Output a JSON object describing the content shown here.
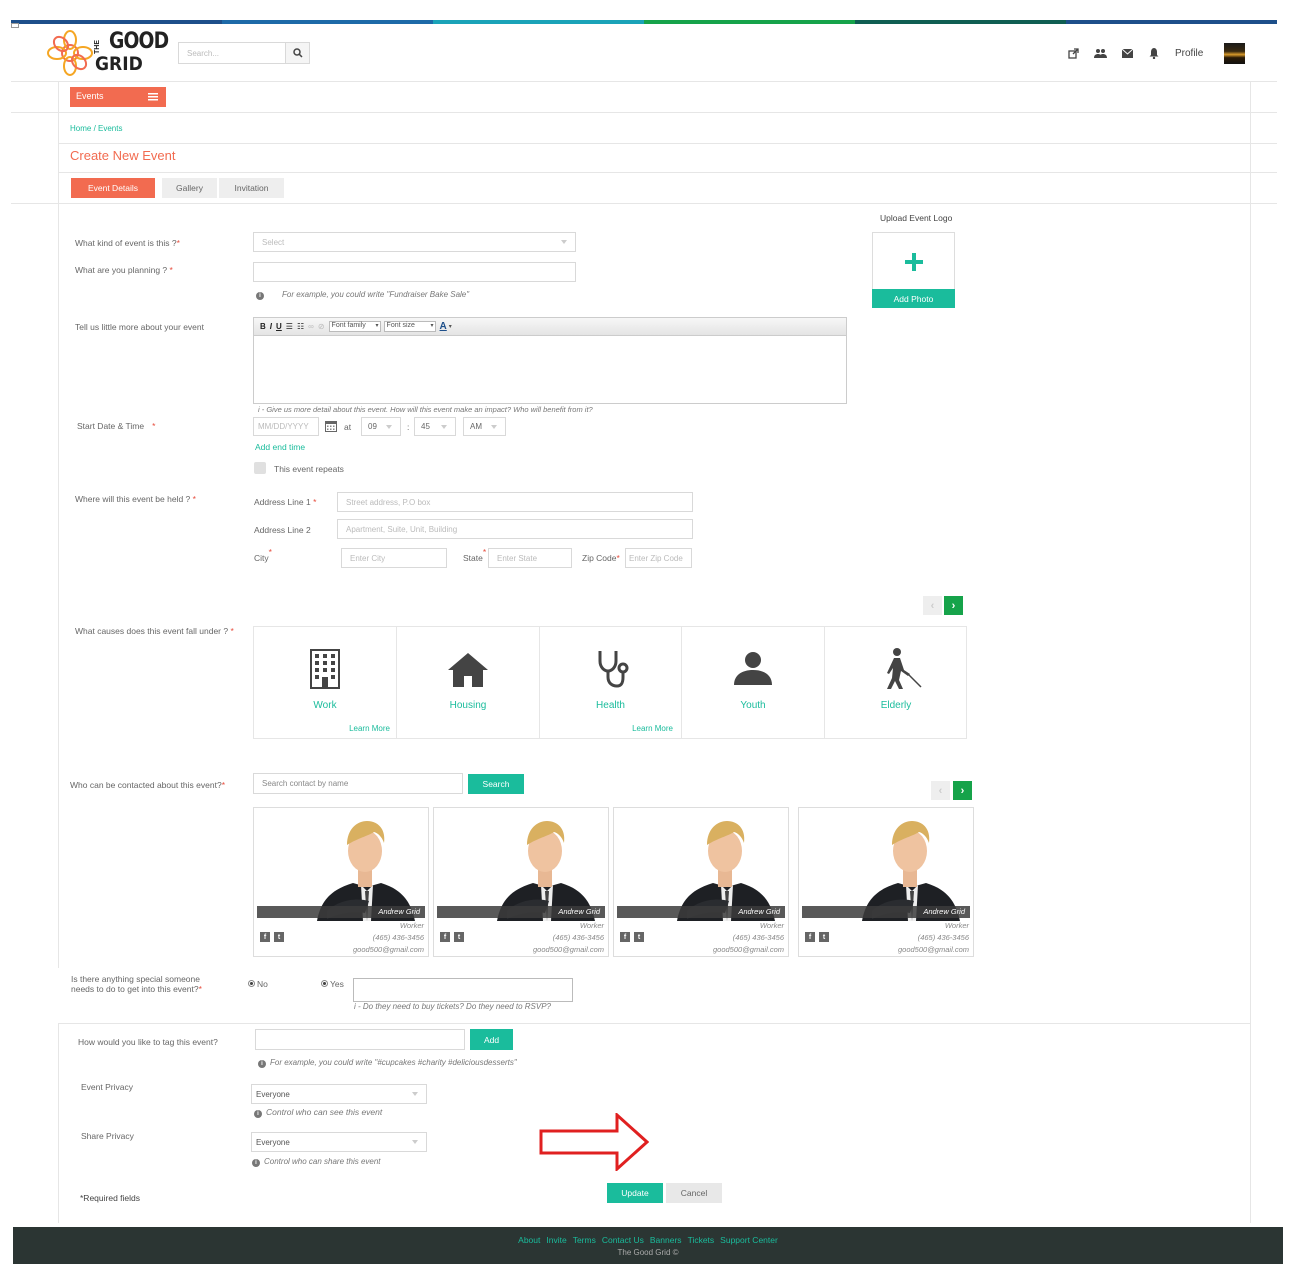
{
  "header": {
    "logo_line1": "THE",
    "logo_line2": "GOOD",
    "logo_line3": "GRID",
    "search_placeholder": "Search...",
    "profile_label": "Profile",
    "icons": [
      "external-link-icon",
      "users-icon",
      "mail-icon",
      "bell-icon"
    ]
  },
  "menu": {
    "events_label": "Events"
  },
  "breadcrumb": {
    "home": "Home",
    "sep": " / ",
    "current": "Events"
  },
  "page_title": "Create New Event",
  "tabs": [
    {
      "label": "Event Details",
      "active": true
    },
    {
      "label": "Gallery",
      "active": false
    },
    {
      "label": "Invitation",
      "active": false
    }
  ],
  "form": {
    "kind_label": "What kind of event is this ?",
    "kind_select": "Select",
    "planning_label": "What are you planning ? ",
    "planning_value": "",
    "planning_hint": "For example, you could write \"Fundraiser Bake Sale\"",
    "about_label": "Tell us little more about your event",
    "editor": {
      "bold": "B",
      "italic": "I",
      "underline": "U",
      "font_family": "Font family",
      "font_size": "Font size",
      "color": "A"
    },
    "about_hint": "i - Give us more detail about this event.  How will this event make an impact?  Who will benefit from it?",
    "start_label": "Start Date & Time",
    "date_placeholder": "MM/DD/YYYY",
    "at_label": "at",
    "hour": "09",
    "colon": ":",
    "minute": "45",
    "ampm": "AM",
    "add_end_time": "Add end time",
    "repeats_label": "This event repeats",
    "where_label": "Where will this event be held ? ",
    "addr1_label": "Address Line 1",
    "addr1_placeholder": "Street address, P.O box",
    "addr2_label": "Address Line 2",
    "addr2_placeholder": "Apartment, Suite, Unit, Building",
    "city_label": "City",
    "city_placeholder": "Enter City",
    "state_label": "State",
    "state_placeholder": "Enter State",
    "zip_label": "Zip Code",
    "zip_placeholder": "Enter Zip Code",
    "causes_label": "What causes does this event fall under ? ",
    "contact_label": "Who can be contacted about this event?",
    "contact_placeholder": "Search contact by name",
    "search_button": "Search",
    "special_label_1": "Is there anything special someone",
    "special_label_2": "needs to do to get into this event?",
    "no_label": "No",
    "yes_label": "Yes",
    "special_hint": "i - Do they need to buy tickets?  Do they need to RSVP?",
    "tag_label": "How would you like to tag this event?",
    "add_button": "Add",
    "tag_hint": "For example, you could write \"#cupcakes #charity #deliciousdesserts\"",
    "privacy_label": "Event Privacy",
    "privacy_value": "Everyone",
    "privacy_hint": "Control who can see this event",
    "share_label": "Share Privacy",
    "share_value": "Everyone",
    "share_hint": "Control who can share this event",
    "required_note": "*Required fields",
    "update_button": "Update",
    "cancel_button": "Cancel",
    "upload_title": "Upload Event Logo",
    "add_photo": "Add Photo",
    "required_mark": "*"
  },
  "causes": [
    {
      "name": "Work",
      "learn_more": "Learn More",
      "icon": "building-icon"
    },
    {
      "name": "Housing",
      "learn_more": "",
      "icon": "house-icon"
    },
    {
      "name": "Health",
      "learn_more": "Learn More",
      "icon": "stethoscope-icon"
    },
    {
      "name": "Youth",
      "learn_more": "",
      "icon": "person-icon"
    },
    {
      "name": "Elderly",
      "learn_more": "",
      "icon": "elderly-person-icon"
    }
  ],
  "contacts": [
    {
      "name": "Andrew Grid",
      "role": "Worker",
      "phone": "(465) 436-3456",
      "email": "good500@gmail.com"
    },
    {
      "name": "Andrew Grid",
      "role": "Worker",
      "phone": "(465) 436-3456",
      "email": "good500@gmail.com"
    },
    {
      "name": "Andrew Grid",
      "role": "Worker",
      "phone": "(465) 436-3456",
      "email": "good500@gmail.com"
    },
    {
      "name": "Andrew Grid",
      "role": "Worker",
      "phone": "(465) 436-3456",
      "email": "good500@gmail.com"
    }
  ],
  "footer": {
    "links": [
      "About",
      "Invite",
      "Terms",
      "Contact Us",
      "Banners",
      "Tickets",
      "Support Center"
    ],
    "copyright": "The Good Grid ©"
  },
  "colors": {
    "accent": "#f26b50",
    "teal": "#1abc9c",
    "green": "#16a34a",
    "footer_bg": "#2b3533"
  }
}
